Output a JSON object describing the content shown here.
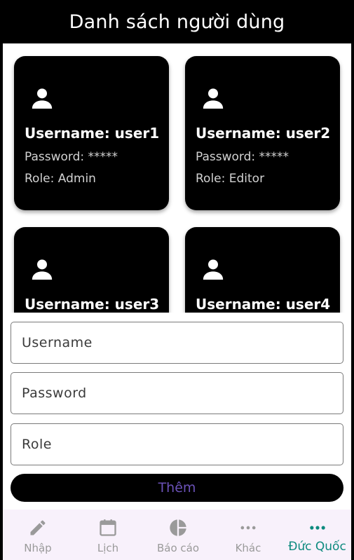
{
  "appbar": {
    "title": "Danh sách người dùng"
  },
  "users": [
    {
      "username": "Username: user1",
      "password": "Password: *****",
      "role": "Role: Admin"
    },
    {
      "username": "Username: user2",
      "password": "Password: *****",
      "role": "Role: Editor"
    },
    {
      "username": "Username: user3"
    },
    {
      "username": "Username: user4"
    }
  ],
  "form": {
    "username_placeholder": "Username",
    "password_placeholder": "Password",
    "role_placeholder": "Role",
    "submit_label": "Thêm"
  },
  "nav": {
    "items": [
      {
        "label": "Nhập",
        "icon": "pencil-icon"
      },
      {
        "label": "Lịch",
        "icon": "calendar-icon"
      },
      {
        "label": "Báo cáo",
        "icon": "pie-chart-icon"
      },
      {
        "label": "Khác",
        "icon": "more-horizontal-icon"
      },
      {
        "label": "Đức Quốc",
        "icon": "more-horizontal-icon"
      }
    ],
    "active_index": 4
  },
  "colors": {
    "appbar_bg": "#000000",
    "card_bg": "#000000",
    "button_text": "#6b52b8",
    "nav_active": "#0c8a7e",
    "nav_inactive": "#9a9a9a",
    "nav_bg": "#f8f1fb"
  }
}
